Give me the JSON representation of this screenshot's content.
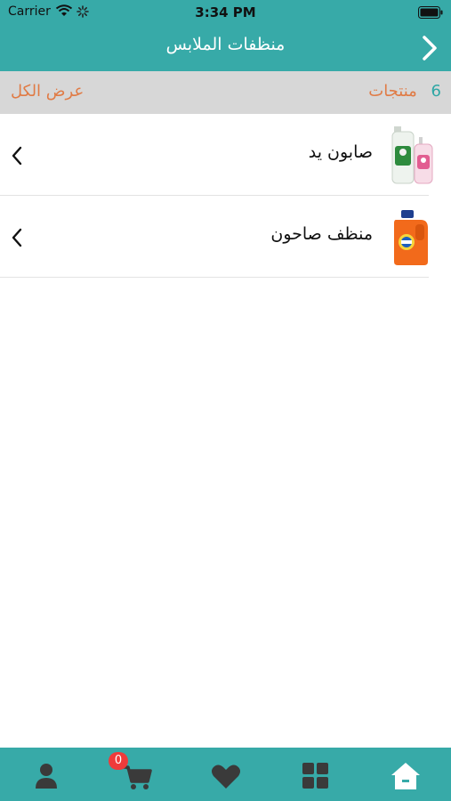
{
  "status_bar": {
    "carrier": "Carrier",
    "time": "3:34 PM"
  },
  "nav": {
    "title": "منظفات الملابس",
    "back_icon": "chevron-right-icon"
  },
  "summary": {
    "view_all": "عرض الكل",
    "count": "6",
    "count_label": "منتجات"
  },
  "products": [
    {
      "name": "صابون يد",
      "icon": "hand-soap-bottles-image"
    },
    {
      "name": "منظف صاحون",
      "icon": "detergent-bottle-image"
    }
  ],
  "tabbar": {
    "cart_badge": "0",
    "items": [
      {
        "icon": "profile-icon"
      },
      {
        "icon": "cart-icon"
      },
      {
        "icon": "heart-icon"
      },
      {
        "icon": "grid-icon"
      },
      {
        "icon": "home-icon"
      }
    ]
  },
  "colors": {
    "teal": "#37aaa8",
    "orange": "#e07b45",
    "badge_red": "#ef3b3b"
  }
}
